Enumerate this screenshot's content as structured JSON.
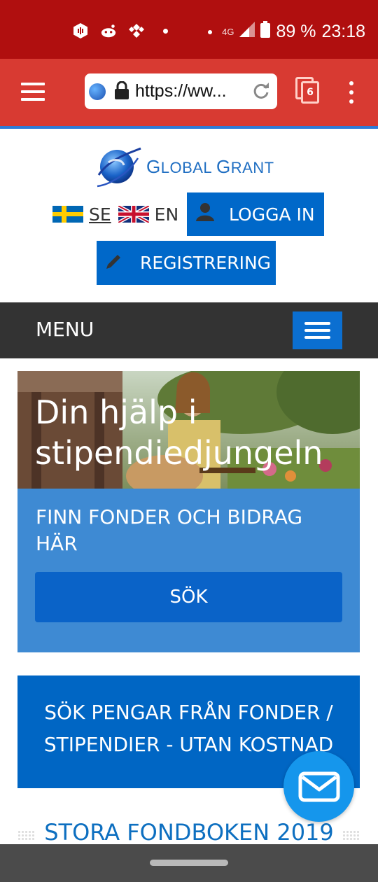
{
  "status_bar": {
    "network": "4G",
    "battery": "89 %",
    "time": "23:18",
    "icons": [
      "hex-notification-icon",
      "reddit-icon",
      "tidal-icon",
      "dot-icon"
    ]
  },
  "browser": {
    "url": "https://ww...",
    "tab_count": "6"
  },
  "header": {
    "logo_text_first_big": "G",
    "logo_text_first_rest": "LOBAL",
    "logo_text_second_big": "G",
    "logo_text_second_rest": "RANT"
  },
  "languages": [
    {
      "code": "SE",
      "flag": "sweden-flag-icon",
      "selected": true
    },
    {
      "code": "EN",
      "flag": "uk-flag-icon",
      "selected": false
    }
  ],
  "buttons": {
    "login": "LOGGA IN",
    "register": "REGISTRERING"
  },
  "menu": {
    "label": "MENU"
  },
  "hero": {
    "headline_line1": "Din hjälp i",
    "headline_line2": "stipendiedjungeln"
  },
  "search_panel": {
    "heading": "FINN FONDER OCH BIDRAG HÄR",
    "button": "SÖK"
  },
  "promo": {
    "text_line1": "SÖK PENGAR FRÅN FONDER /",
    "text_line2": "STIPENDIER - UTAN KOSTNAD"
  },
  "book": {
    "title": "STORA FONDBOKEN 2019"
  },
  "colors": {
    "status_bar": "#b00f0f",
    "browser_bar": "#d83a32",
    "primary_blue": "#0068c9",
    "panel_blue": "#3e8ad3",
    "menu_bar": "#333333",
    "fab": "#1596ec"
  }
}
